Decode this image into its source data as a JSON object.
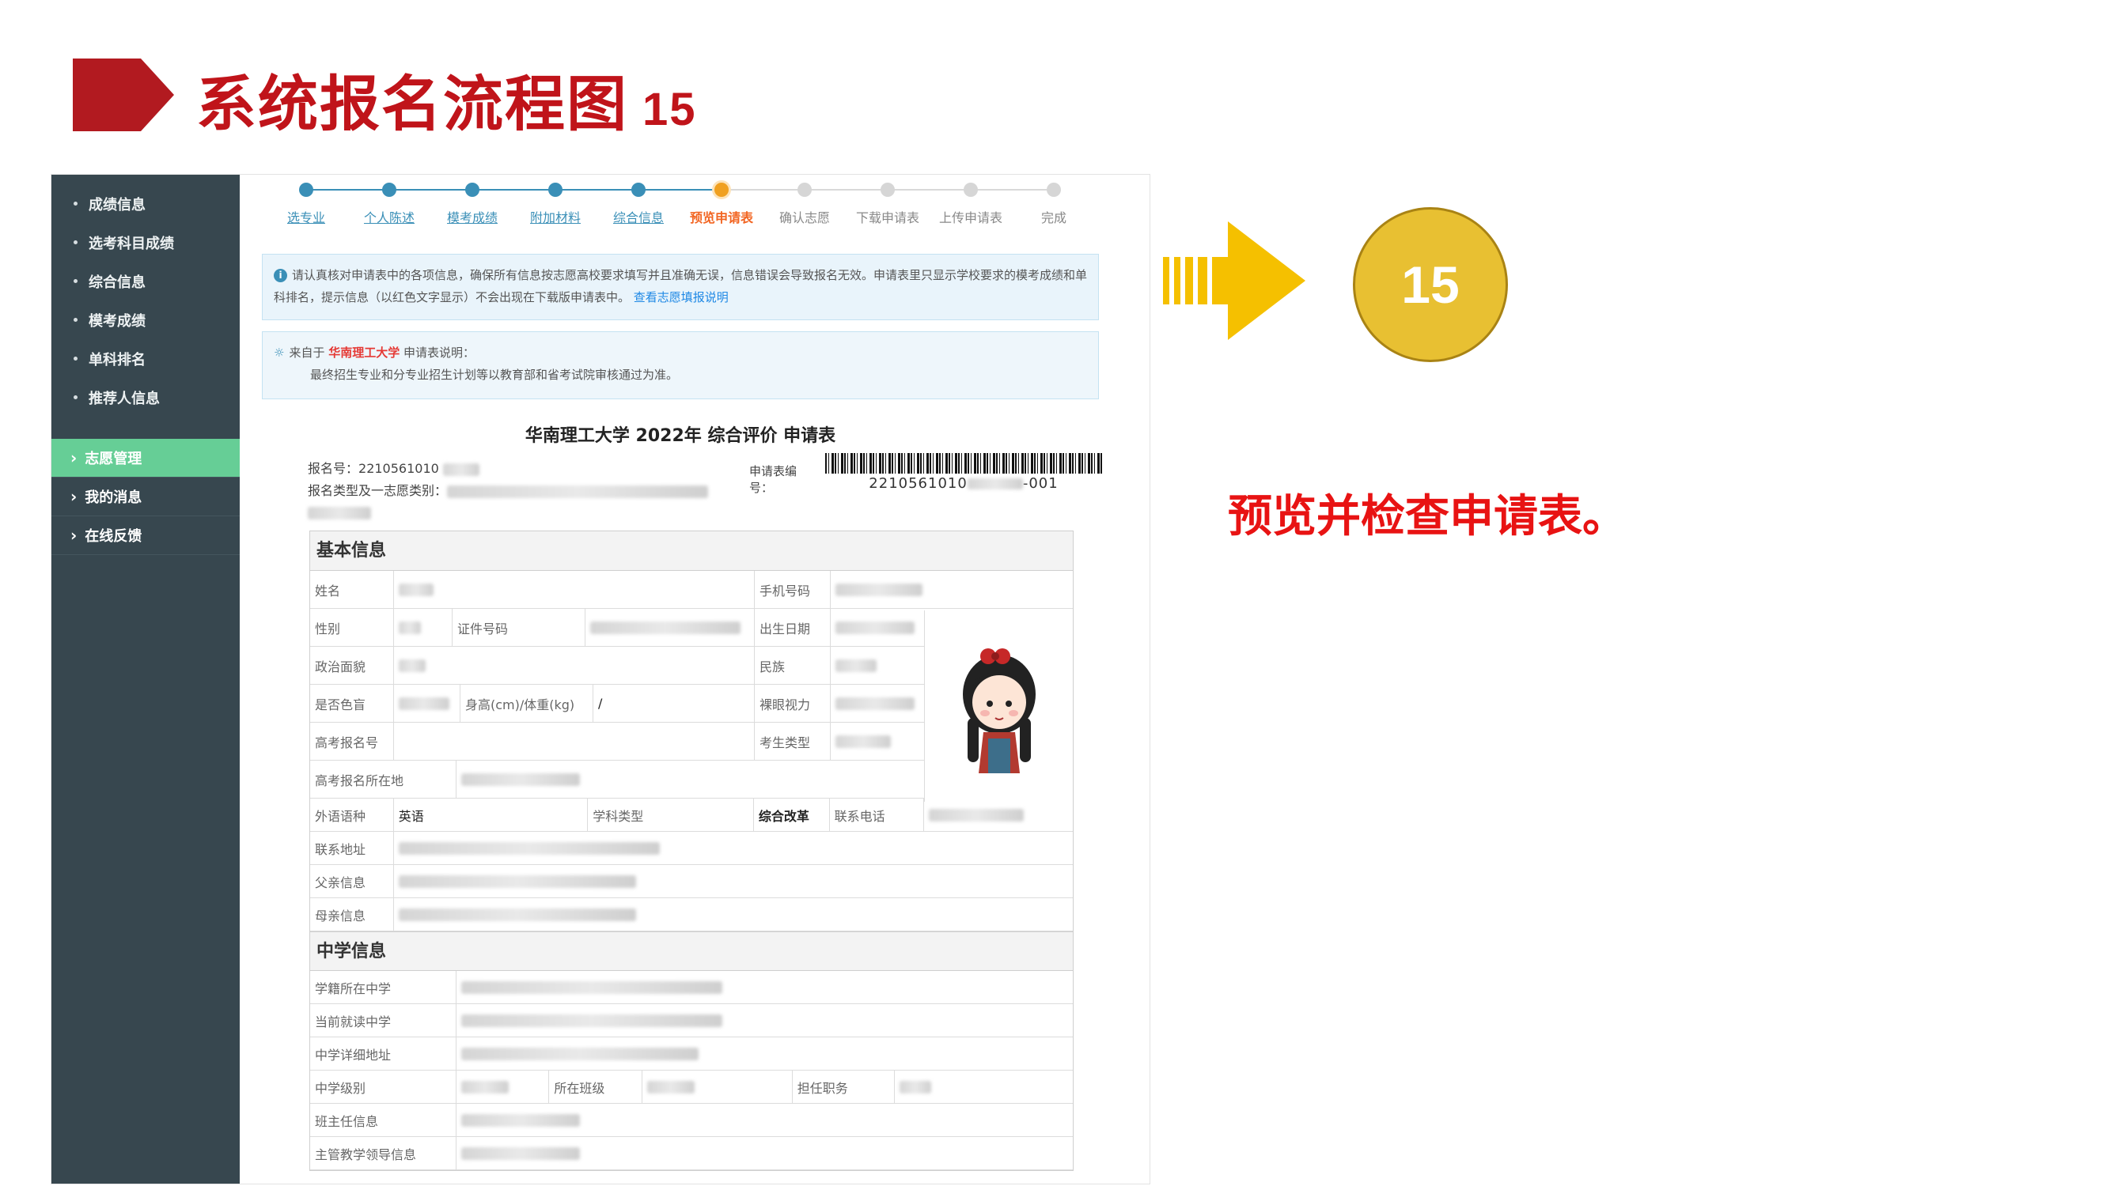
{
  "slide": {
    "title": "系统报名流程图",
    "number": "15",
    "badge": "15",
    "caption": "预览并检查申请表。",
    "accent_red": "#c0141a",
    "caption_red": "#e81313",
    "arrow_yellow": "#f5c000",
    "badge_color": "#e8c032"
  },
  "sidebar": {
    "items": [
      {
        "label": "成绩信息"
      },
      {
        "label": "选考科目成绩"
      },
      {
        "label": "综合信息"
      },
      {
        "label": "模考成绩"
      },
      {
        "label": "单科排名"
      },
      {
        "label": "推荐人信息"
      }
    ],
    "nav": [
      {
        "label": "志愿管理",
        "active": true
      },
      {
        "label": "我的消息"
      },
      {
        "label": "在线反馈"
      }
    ]
  },
  "stepper": {
    "steps": [
      {
        "label": "选专业",
        "state": "done"
      },
      {
        "label": "个人陈述",
        "state": "done"
      },
      {
        "label": "模考成绩",
        "state": "done"
      },
      {
        "label": "附加材料",
        "state": "done"
      },
      {
        "label": "综合信息",
        "state": "done"
      },
      {
        "label": "预览申请表",
        "state": "current"
      },
      {
        "label": "确认志愿",
        "state": "todo"
      },
      {
        "label": "下载申请表",
        "state": "todo"
      },
      {
        "label": "上传申请表",
        "state": "todo"
      },
      {
        "label": "完成",
        "state": "todo"
      }
    ]
  },
  "notice": {
    "text": "请认真核对申请表中的各项信息，确保所有信息按志愿高校要求填写并且准确无误，信息错误会导致报名无效。申请表里只显示学校要求的模考成绩和单科排名，提示信息（以红色文字显示）不会出现在下载版申请表中。",
    "link": "查看志愿填报说明"
  },
  "notice2": {
    "prefix": "来自于",
    "school": "华南理工大学",
    "suffix": "申请表说明：",
    "line2": "最终招生专业和分专业招生计划等以教育部和省考试院审核通过为准。"
  },
  "form": {
    "title": "华南理工大学 2022年 综合评价 申请表",
    "reg_no_label": "报名号：",
    "reg_no_value": "2210561010",
    "type_label": "报名类型及一志愿类别：",
    "app_no_label": "申请表编号：",
    "app_no_value_prefix": "2210561010",
    "app_no_value_suffix": "-001",
    "sections": {
      "basic": "基本信息",
      "school": "中学信息"
    },
    "basic": {
      "name": "姓名",
      "phone": "手机号码",
      "gender": "性别",
      "id_no": "证件号码",
      "birth": "出生日期",
      "politics": "政治面貌",
      "ethnic": "民族",
      "colorblind": "是否色盲",
      "height_weight": "身高(cm)/体重(kg)",
      "height_weight_value": "/",
      "eyesight": "裸眼视力",
      "gk_no": "高考报名号",
      "exam_type": "考生类型",
      "gk_place": "高考报名所在地",
      "lang": "外语语种",
      "lang_value": "英语",
      "subject_type": "学科类型",
      "subject_type_value": "综合改革",
      "contact_phone": "联系电话",
      "address": "联系地址",
      "father": "父亲信息",
      "mother": "母亲信息"
    },
    "school": {
      "reg_school": "学籍所在中学",
      "cur_school": "当前就读中学",
      "school_addr": "中学详细地址",
      "level": "中学级别",
      "class": "所在班级",
      "duty": "担任职务",
      "teacher": "班主任信息",
      "leader": "主管教学领导信息"
    }
  }
}
